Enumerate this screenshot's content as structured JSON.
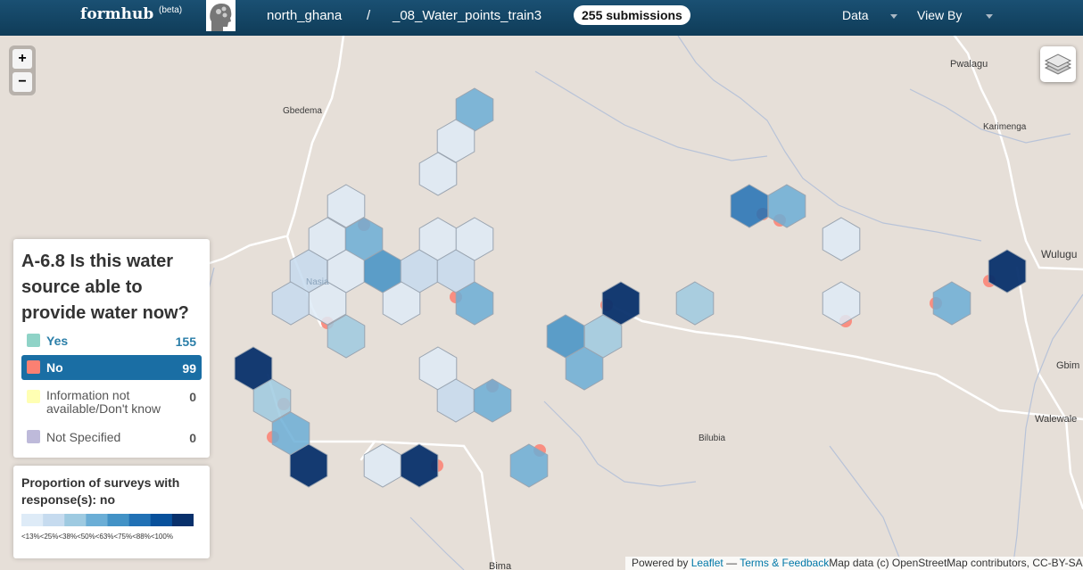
{
  "topbar": {
    "brand": "formhub",
    "beta": "(beta)",
    "user": "north_ghana",
    "separator": "/",
    "form": "_08_Water_points_train3",
    "submissions": "255 submissions",
    "nav": [
      {
        "label": "Data"
      },
      {
        "label": "View By"
      }
    ]
  },
  "map": {
    "zoom_in": "+",
    "zoom_out": "−",
    "layers_icon": "layers-icon",
    "places": [
      "Pwalagu",
      "Gbedema",
      "Karimenga",
      "Wulugu",
      "Gbim",
      "Walewale",
      "Bilubia",
      "Bima",
      "Nasia"
    ]
  },
  "legend": {
    "title": "A-6.8 Is this water source able to provide water now?",
    "items": [
      {
        "label": "Yes",
        "count": "155",
        "color": "#8fd3c7",
        "selected": false
      },
      {
        "label": "No",
        "count": "99",
        "color": "#fb8072",
        "selected": true
      },
      {
        "label": "Information not available/Don't know",
        "count": "0",
        "color": "#ffffb3",
        "selected": false
      },
      {
        "label": "Not Specified",
        "count": "0",
        "color": "#bebada",
        "selected": false
      }
    ]
  },
  "scale": {
    "title": "Proportion of surveys with response(s): no",
    "labels": [
      "<13%",
      "<25%",
      "<38%",
      "<50%",
      "<63%",
      "<75%",
      "<88%",
      "<100%"
    ],
    "colors": [
      "#deebf7",
      "#c6dbef",
      "#9ecae1",
      "#6baed6",
      "#4292c6",
      "#2171b5",
      "#08519c",
      "#08306b"
    ]
  },
  "attribution": {
    "powered": "Powered by ",
    "leaflet": "Leaflet",
    "dash": " — ",
    "terms": "Terms & Feedback",
    "mapdata": "Map data (c) OpenStreetMap contributors, CC-BY-SA"
  }
}
